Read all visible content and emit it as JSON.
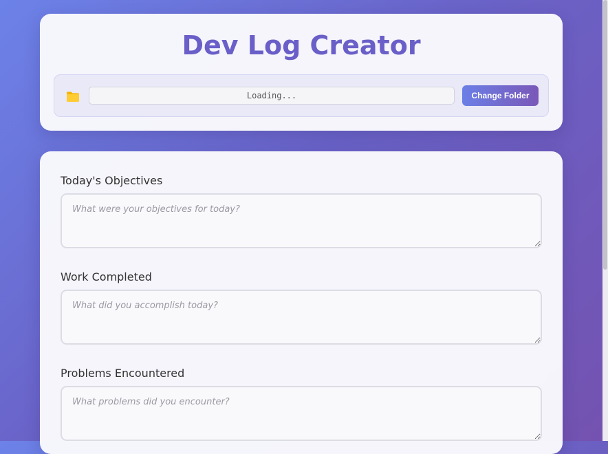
{
  "header": {
    "title": "Dev Log Creator",
    "folder_icon": "folder-icon",
    "folder_path": "Loading...",
    "change_folder_label": "Change Folder"
  },
  "form": {
    "fields": [
      {
        "label": "Today's Objectives",
        "placeholder": "What were your objectives for today?",
        "value": ""
      },
      {
        "label": "Work Completed",
        "placeholder": "What did you accomplish today?",
        "value": ""
      },
      {
        "label": "Problems Encountered",
        "placeholder": "What problems did you encounter?",
        "value": ""
      }
    ]
  },
  "colors": {
    "accent": "#6a5fc8",
    "background_start": "#6c82e8",
    "background_end": "#7452b0"
  }
}
